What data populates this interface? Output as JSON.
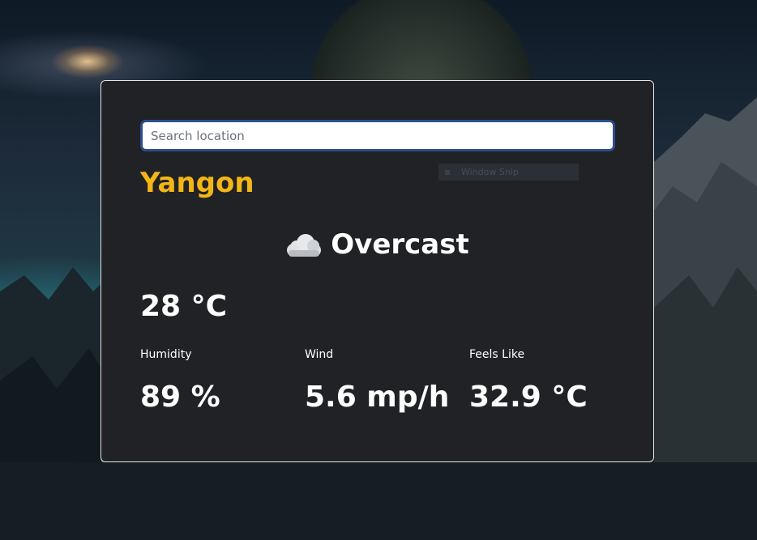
{
  "search": {
    "placeholder": "Search location",
    "value": ""
  },
  "weather": {
    "city": "Yangon",
    "condition_icon": "cloud-icon",
    "condition": "Overcast",
    "temperature": "28 °C",
    "stats": [
      {
        "label": "Humidity",
        "value": "89 %"
      },
      {
        "label": "Wind",
        "value": "5.6 mp/h"
      },
      {
        "label": "Feels Like",
        "value": "32.9 °C"
      }
    ]
  },
  "overlay": {
    "ghost_label": "Window Snip"
  },
  "colors": {
    "card_background": "#202226",
    "city_accent": "#f4b615",
    "text": "#ffffff",
    "search_focus_border": "#2c4e8c"
  }
}
